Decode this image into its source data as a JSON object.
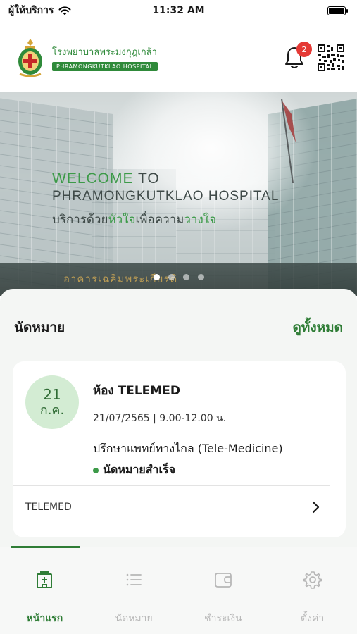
{
  "status_bar": {
    "carrier": "ผู้ให้บริการ",
    "time": "11:32 AM"
  },
  "header": {
    "hospital_name_th": "โรงพยาบาลพระมงกุฎเกล้า",
    "hospital_name_en": "PHRAMONGKUTKLAO HOSPITAL",
    "notification_count": "2",
    "icons": [
      "logo-emblem",
      "bell-icon",
      "qr-code-icon"
    ]
  },
  "banner": {
    "welcome_word": "WELCOME",
    "welcome_to": " TO",
    "hospital_line": "PHRAMONGKUTKLAO HOSPITAL",
    "slogan_a": "บริการด้วย",
    "slogan_b": "หัวใจ",
    "slogan_c": "เพื่อความ",
    "slogan_d": "วางใจ",
    "building_sign": "อาคารเฉลิมพระเกียรติ",
    "slides_total": 4,
    "active_slide": 1
  },
  "appointments": {
    "section_title": "นัดหมาย",
    "see_all": "ดูทั้งหมด",
    "card": {
      "day": "21",
      "month": "ก.ค.",
      "room": "ห้อง TELEMED",
      "datetime": "21/07/2565 | 9.00-12.00 น.",
      "service": "ปรึกษาแพทย์ทางไกล (Tele-Medicine)",
      "status": "นัดหมายสำเร็จ",
      "footer_label": "TELEMED"
    }
  },
  "tabbar": {
    "tabs": [
      {
        "label": "หน้าแรก",
        "icon": "hospital-icon",
        "active": true
      },
      {
        "label": "นัดหมาย",
        "icon": "list-icon",
        "active": false
      },
      {
        "label": "ชำระเงิน",
        "icon": "wallet-icon",
        "active": false
      },
      {
        "label": "ตั้งค่า",
        "icon": "gear-icon",
        "active": false
      }
    ]
  },
  "colors": {
    "brand_green": "#2f7d36",
    "accent_green": "#3c9a48",
    "date_circle": "#d3ecd3",
    "badge_red": "#e53935"
  }
}
